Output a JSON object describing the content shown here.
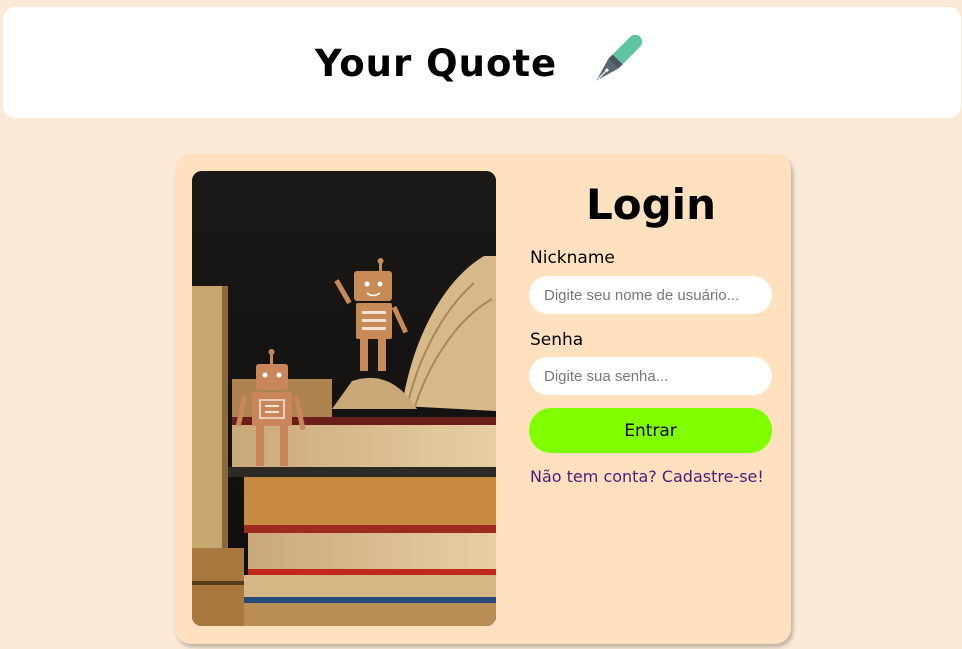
{
  "header": {
    "title": "Your Quote",
    "icon": "fountain-pen-icon"
  },
  "login": {
    "title": "Login",
    "nickname_label": "Nickname",
    "nickname_placeholder": "Digite seu nome de usuário...",
    "password_label": "Senha",
    "password_placeholder": "Digite sua senha...",
    "submit_label": "Entrar",
    "signup_link": "Não tem conta? Cadastre-se!"
  },
  "colors": {
    "page_background": "#fae9d7",
    "card_background": "#ffe1bf",
    "button": "#80ff00",
    "link": "#4b1d7a"
  }
}
